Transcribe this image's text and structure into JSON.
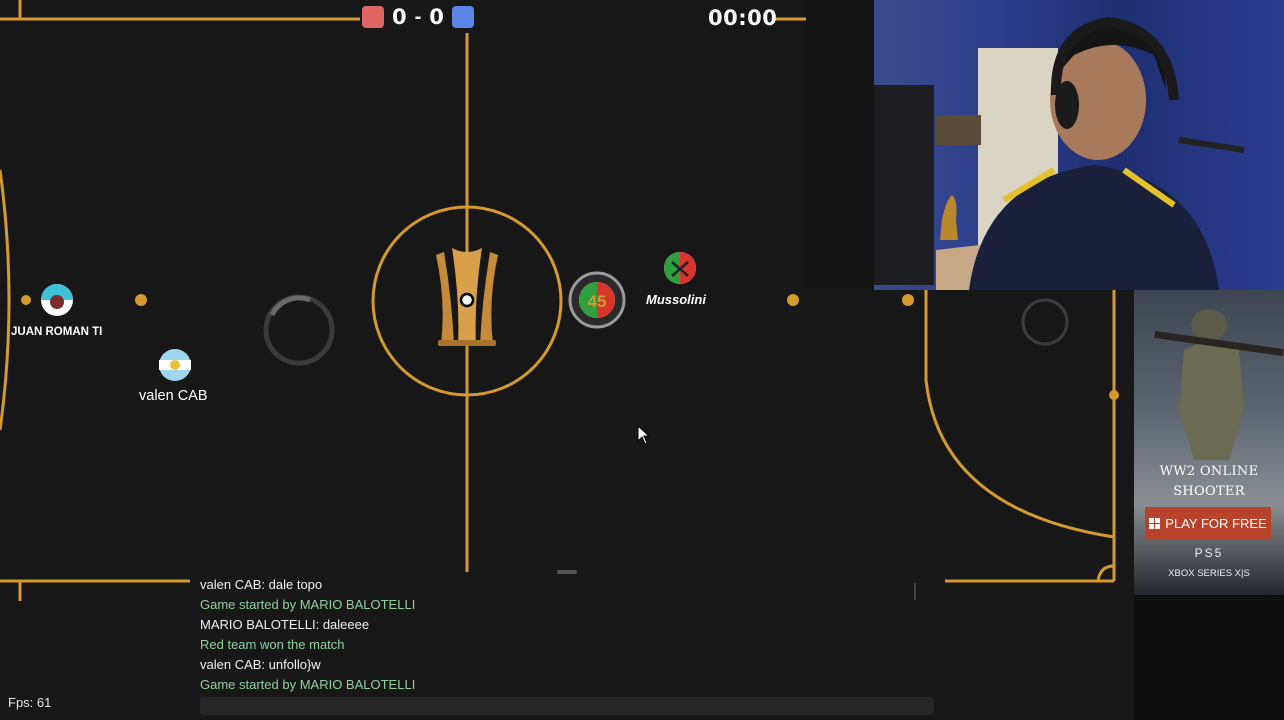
{
  "scoreboard": {
    "red_score": "0",
    "separator": "-",
    "blue_score": "0",
    "timer": "00:00",
    "red_color": "#e06666",
    "blue_color": "#5b86e5"
  },
  "players": {
    "juan": {
      "name": "JUAN ROMAN TI"
    },
    "valen": {
      "name": "valen CAB"
    },
    "mussolini": {
      "name": "Mussolini",
      "avatar_text": "45"
    }
  },
  "field": {
    "line_color": "#d4992f",
    "background": "#171717",
    "logo": "trophy-logo"
  },
  "chat": {
    "messages": [
      {
        "text": "valen CAB: dale topo",
        "kind": "chat"
      },
      {
        "text": "Game started by MARIO BALOTELLI",
        "kind": "notice"
      },
      {
        "text": "MARIO BALOTELLI: daleeee",
        "kind": "chat"
      },
      {
        "text": "Red team won the match",
        "kind": "notice"
      },
      {
        "text": "valen CAB: unfollo}w",
        "kind": "chat"
      },
      {
        "text": "Game started by MARIO BALOTELLI",
        "kind": "notice"
      }
    ]
  },
  "status": {
    "fps": "Fps: 61"
  },
  "ad": {
    "title_line1": "WW2 ONLINE",
    "title_line2": "SHOOTER",
    "button": "PLAY FOR FREE",
    "platform1": "PS5",
    "platform2": "XBOX SERIES X|S"
  }
}
